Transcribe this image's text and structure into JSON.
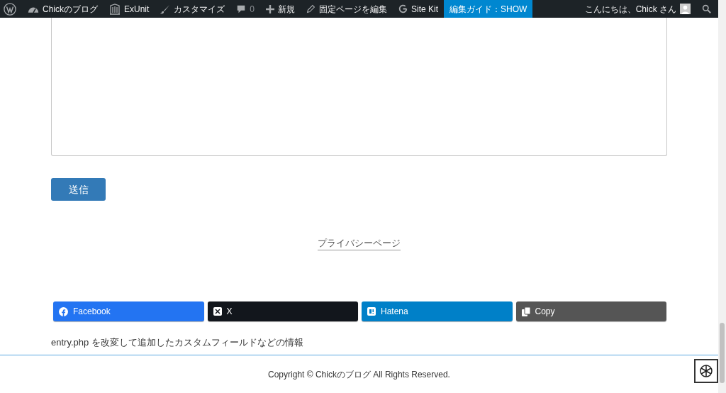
{
  "admin_bar": {
    "items": [
      {
        "kind": "wordpress",
        "highlighted": false
      },
      {
        "kind": "dashboard",
        "label": "Chickのブログ",
        "highlighted": false
      },
      {
        "kind": "exunit",
        "label": "ExUnit",
        "highlighted": false
      },
      {
        "kind": "brush",
        "label": "カスタマイズ",
        "highlighted": false
      },
      {
        "kind": "comment",
        "label": "0",
        "highlighted": false
      },
      {
        "kind": "plus",
        "label": "新規",
        "highlighted": false
      },
      {
        "kind": "pencil",
        "label": "固定ページを編集",
        "highlighted": false
      },
      {
        "kind": "google",
        "label": "Site Kit",
        "highlighted": false
      },
      {
        "kind": "none",
        "label": "編集ガイド：SHOW",
        "highlighted": true
      }
    ],
    "greeting": "こんにちは、Chick さん"
  },
  "form": {
    "submit": "送信"
  },
  "privacy_link": "プライバシーページ",
  "share_buttons": [
    {
      "kind": "facebook",
      "label": "Facebook",
      "color": "#2374f2"
    },
    {
      "kind": "x",
      "label": "X",
      "color": "#12161c"
    },
    {
      "kind": "hatena",
      "label": "Hatena",
      "color": "#0080c8"
    },
    {
      "kind": "copy",
      "label": "Copy",
      "color": "#555555"
    }
  ],
  "custom_field_info": "entry.php を改変して追加したカスタムフィールドなどの情報",
  "footer": {
    "copyright": "Copyright © Chickのブログ All Rights Reserved."
  }
}
